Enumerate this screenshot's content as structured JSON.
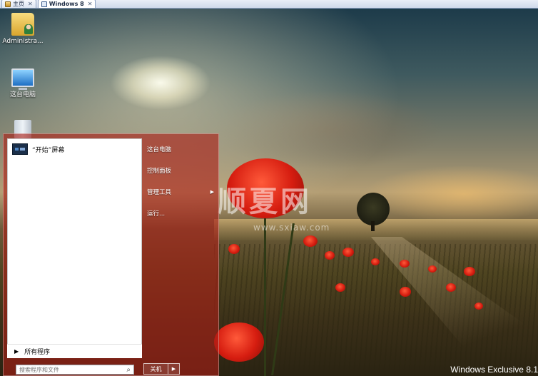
{
  "vm_tabs": [
    {
      "label": "主页",
      "icon": "home-icon",
      "active": false
    },
    {
      "label": "Windows 8",
      "icon": "vm-icon",
      "active": true
    }
  ],
  "desktop": {
    "icons": [
      {
        "label": "Administra...",
        "icon": "user-folder-icon"
      },
      {
        "label": "这台电脑",
        "icon": "computer-icon"
      },
      {
        "label": "",
        "icon": "recycle-bin-icon"
      }
    ],
    "watermark_cn": "顺夏网",
    "watermark_url": "www.sxiaw.com",
    "build_text": "Windows Exclusive 8.1"
  },
  "start_menu": {
    "pinned": [
      {
        "label": "“开始”屏幕",
        "icon": "start-screen-icon"
      }
    ],
    "all_programs_label": "所有程序",
    "search_placeholder": "搜索程序和文件",
    "right_items": [
      {
        "label": "这台电脑",
        "has_submenu": false
      },
      {
        "label": "控制面板",
        "has_submenu": false
      },
      {
        "label": "管理工具",
        "has_submenu": true
      },
      {
        "label": "运行...",
        "has_submenu": false
      }
    ],
    "shutdown_label": "关机",
    "accent_color": "#aa1e16"
  }
}
